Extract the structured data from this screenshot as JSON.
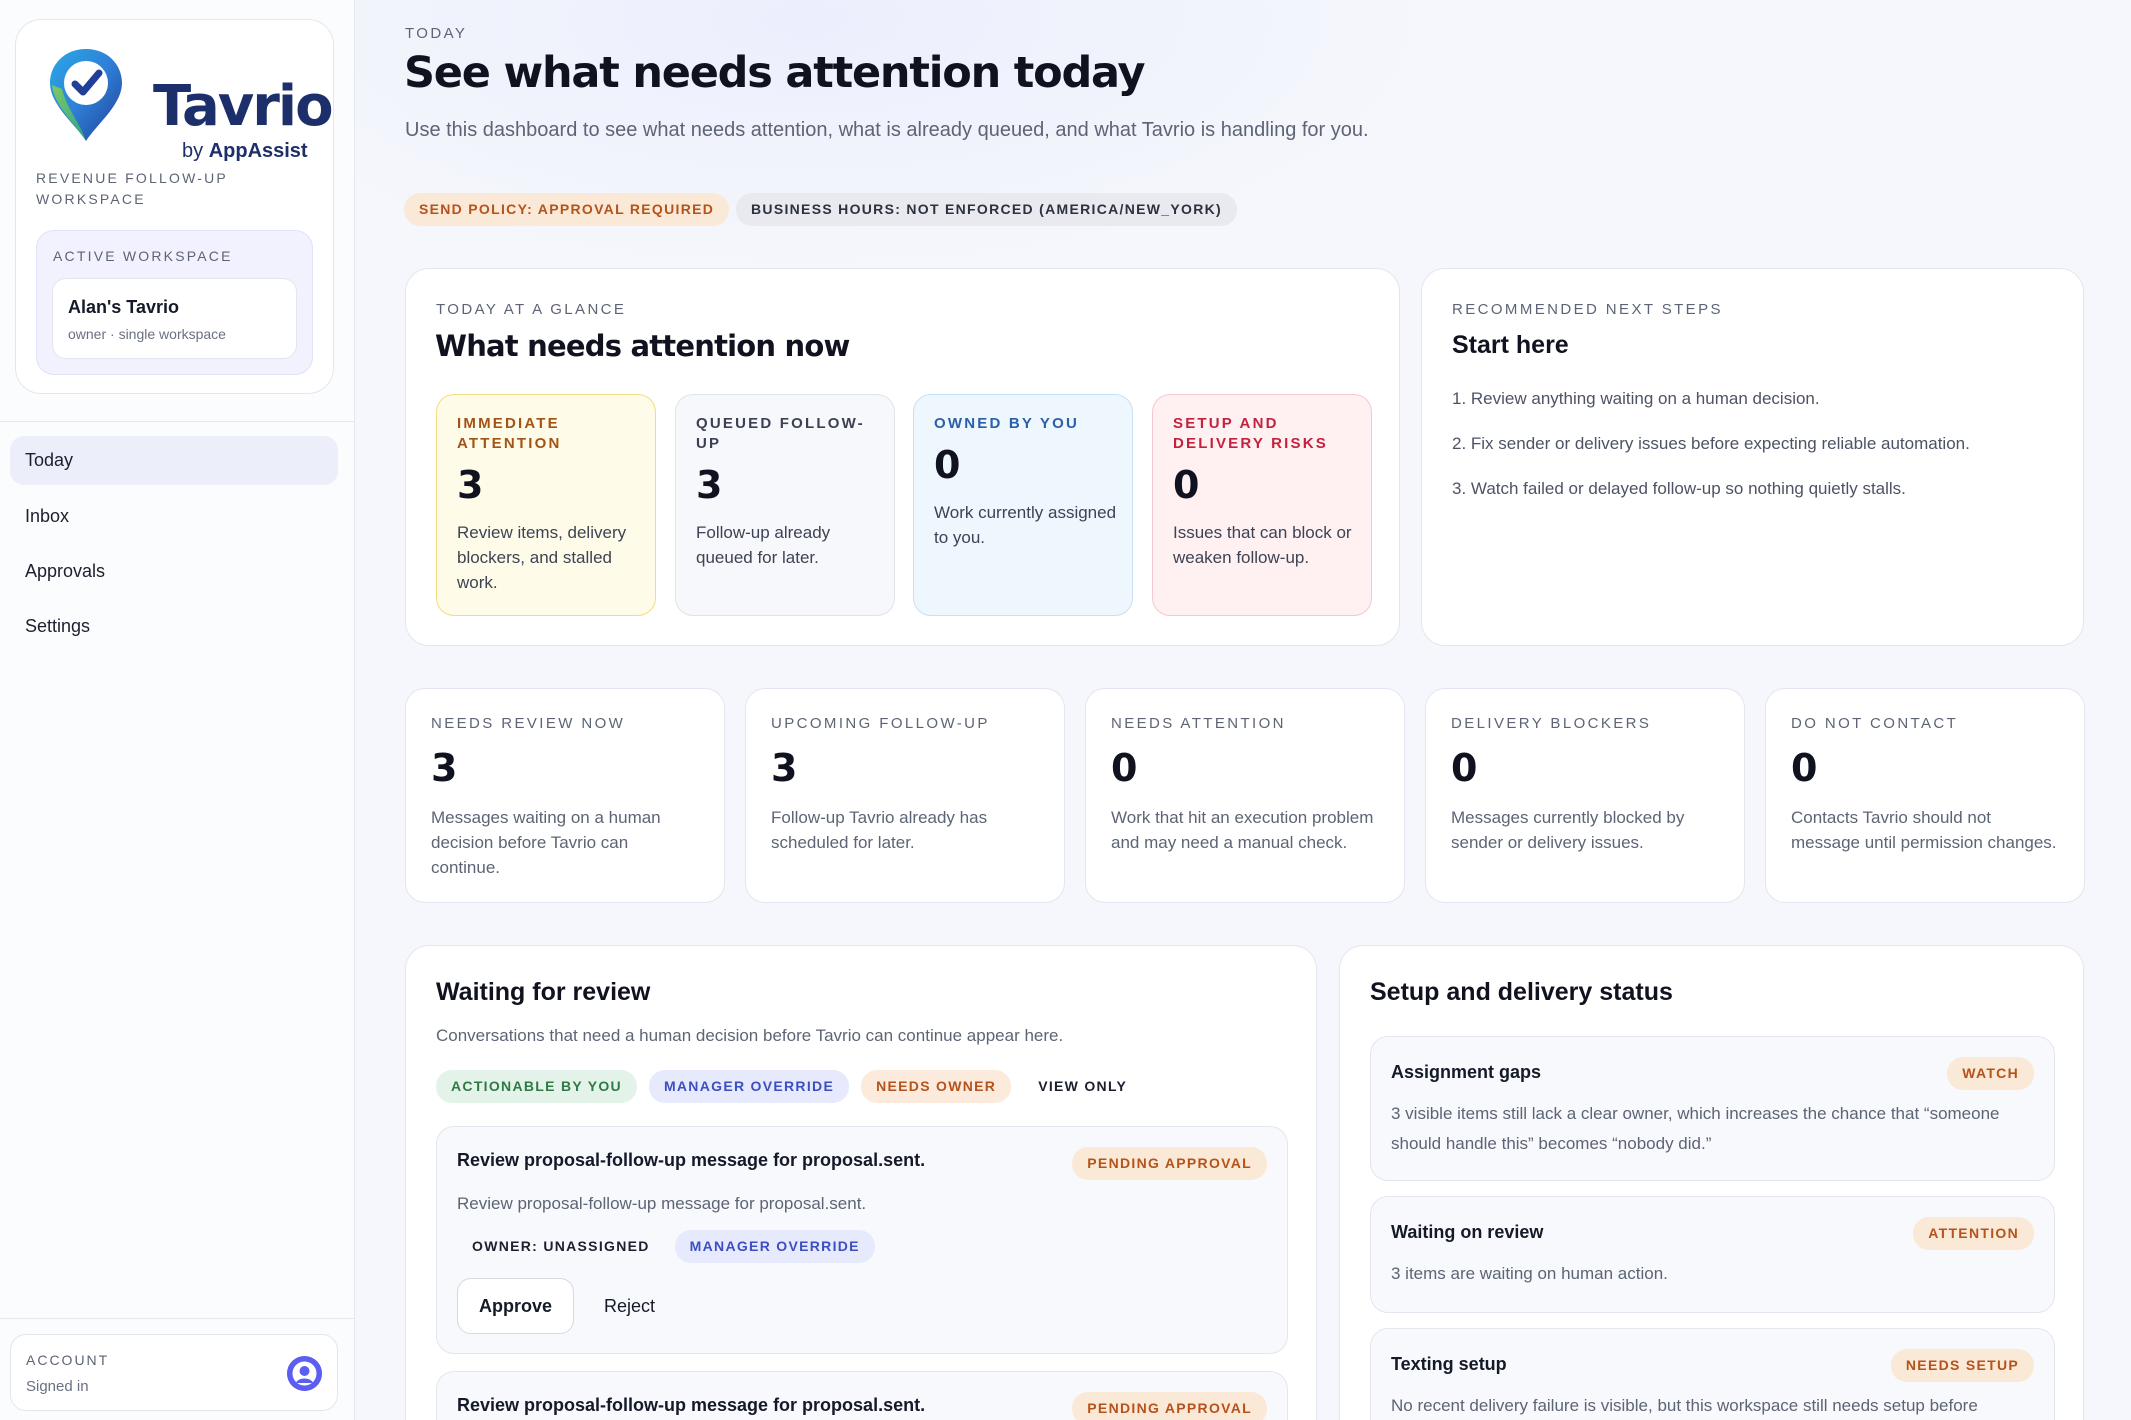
{
  "brand": {
    "name": "Tavrio",
    "by_prefix": "by",
    "by_name": "AppAssist",
    "workspace_kicker": "REVENUE FOLLOW-UP WORKSPACE"
  },
  "active_workspace": {
    "kicker": "ACTIVE WORKSPACE",
    "name": "Alan's Tavrio",
    "role": "owner · single workspace"
  },
  "nav": {
    "items": [
      {
        "label": "Today",
        "active": true
      },
      {
        "label": "Inbox",
        "active": false
      },
      {
        "label": "Approvals",
        "active": false
      },
      {
        "label": "Settings",
        "active": false
      }
    ]
  },
  "account": {
    "kicker": "ACCOUNT",
    "status": "Signed in"
  },
  "header": {
    "kicker": "TODAY",
    "title": "See what needs attention today",
    "description": "Use this dashboard to see what needs attention, what is already queued, and what Tavrio is handling for you.",
    "policy_pill": "SEND POLICY: APPROVAL REQUIRED",
    "hours_pill": "BUSINESS HOURS: NOT ENFORCED (AMERICA/NEW_YORK)"
  },
  "glance": {
    "kicker": "TODAY AT A GLANCE",
    "title": "What needs attention now",
    "tiles": [
      {
        "label": "IMMEDIATE ATTENTION",
        "value": "3",
        "desc": "Review items, delivery blockers, and stalled work."
      },
      {
        "label": "QUEUED FOLLOW-UP",
        "value": "3",
        "desc": "Follow-up already queued for later."
      },
      {
        "label": "OWNED BY YOU",
        "value": "0",
        "desc": "Work currently assigned to you."
      },
      {
        "label": "SETUP AND DELIVERY RISKS",
        "value": "0",
        "desc": "Issues that can block or weaken follow-up."
      }
    ]
  },
  "next_steps": {
    "kicker": "RECOMMENDED NEXT STEPS",
    "title": "Start here",
    "items": [
      "1. Review anything waiting on a human decision.",
      "2. Fix sender or delivery issues before expecting reliable automation.",
      "3. Watch failed or delayed follow-up so nothing quietly stalls."
    ]
  },
  "metrics": [
    {
      "label": "NEEDS REVIEW NOW",
      "value": "3",
      "desc": "Messages waiting on a human decision before Tavrio can continue."
    },
    {
      "label": "UPCOMING FOLLOW-UP",
      "value": "3",
      "desc": "Follow-up Tavrio already has scheduled for later."
    },
    {
      "label": "NEEDS ATTENTION",
      "value": "0",
      "desc": "Work that hit an execution problem and may need a manual check."
    },
    {
      "label": "DELIVERY BLOCKERS",
      "value": "0",
      "desc": "Messages currently blocked by sender or delivery issues."
    },
    {
      "label": "DO NOT CONTACT",
      "value": "0",
      "desc": "Contacts Tavrio should not message until permission changes."
    }
  ],
  "review": {
    "title": "Waiting for review",
    "description": "Conversations that need a human decision before Tavrio can continue appear here.",
    "filters": [
      "ACTIONABLE BY YOU",
      "MANAGER OVERRIDE",
      "NEEDS OWNER",
      "VIEW ONLY"
    ],
    "items": [
      {
        "title": "Review proposal-follow-up message for proposal.sent.",
        "badge": "PENDING APPROVAL",
        "body": "Review proposal-follow-up message for proposal.sent.",
        "owner_tag": "OWNER: UNASSIGNED",
        "override_tag": "MANAGER OVERRIDE",
        "approve_label": "Approve",
        "reject_label": "Reject"
      },
      {
        "title": "Review proposal-follow-up message for proposal.sent.",
        "badge": "PENDING APPROVAL"
      }
    ]
  },
  "setup_status": {
    "title": "Setup and delivery status",
    "items": [
      {
        "title": "Assignment gaps",
        "badge": "WATCH",
        "body": "3 visible items still lack a clear owner, which increases the chance that “someone should handle this” becomes “nobody did.”"
      },
      {
        "title": "Waiting on review",
        "badge": "ATTENTION",
        "body": "3 items are waiting on human action."
      },
      {
        "title": "Texting setup",
        "badge": "NEEDS SETUP",
        "body": "No recent delivery failure is visible, but this workspace still needs setup before"
      }
    ]
  },
  "colors": {
    "accent": "#5b5ef0",
    "brand_navy": "#1c2f6b",
    "warning_text": "#b4531a",
    "danger_text": "#c2223e"
  }
}
